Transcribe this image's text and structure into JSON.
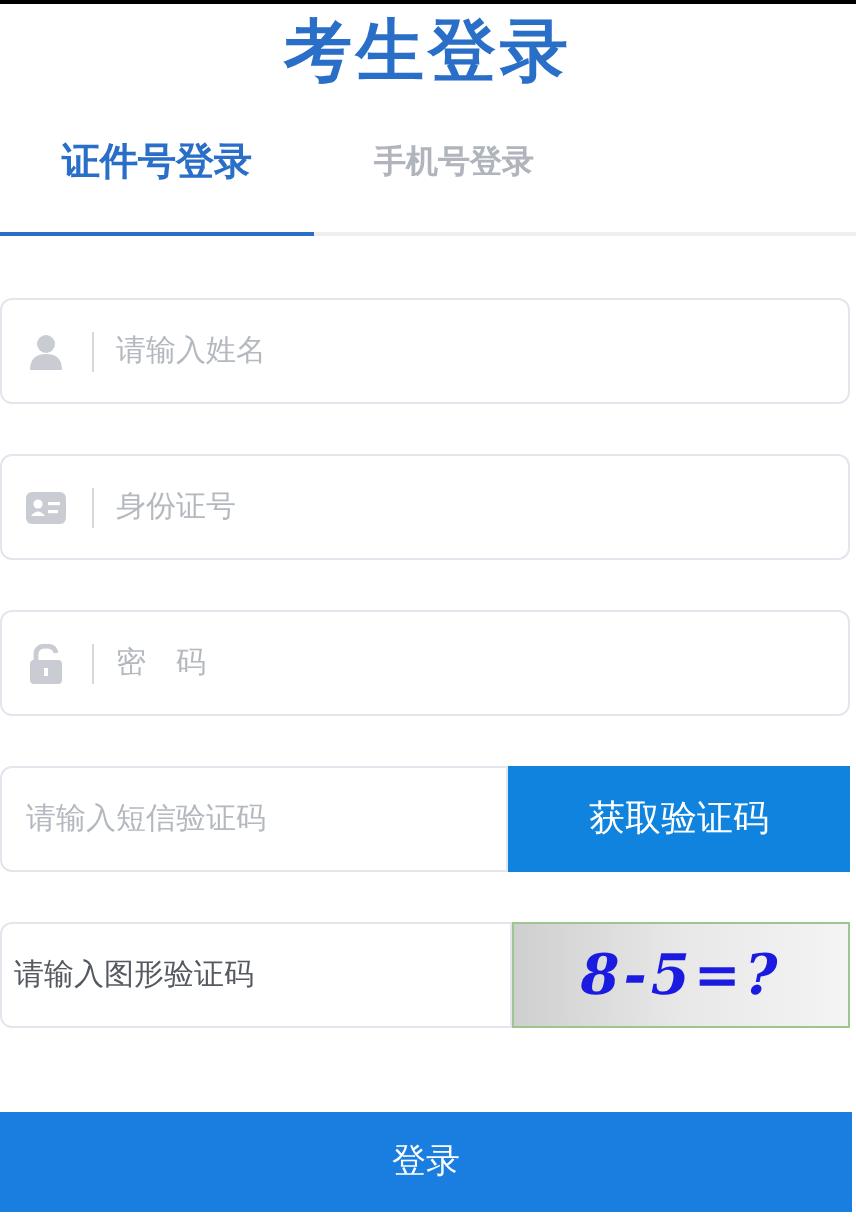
{
  "title": "考生登录",
  "tabs": [
    {
      "label": "证件号登录",
      "selected": true
    },
    {
      "label": "手机号登录",
      "selected": false
    }
  ],
  "fields": [
    {
      "kind": "name",
      "placeholder": "请输入姓名"
    },
    {
      "kind": "idcard",
      "placeholder": "身份证号"
    },
    {
      "kind": "password",
      "placeholder": "密　码"
    },
    {
      "kind": "sms",
      "placeholder": "请输入短信验证码",
      "button": "获取验证码"
    },
    {
      "kind": "captcha",
      "placeholder": "请输入图形验证码",
      "captcha_text": "8-5=?"
    }
  ],
  "submit": "登录"
}
